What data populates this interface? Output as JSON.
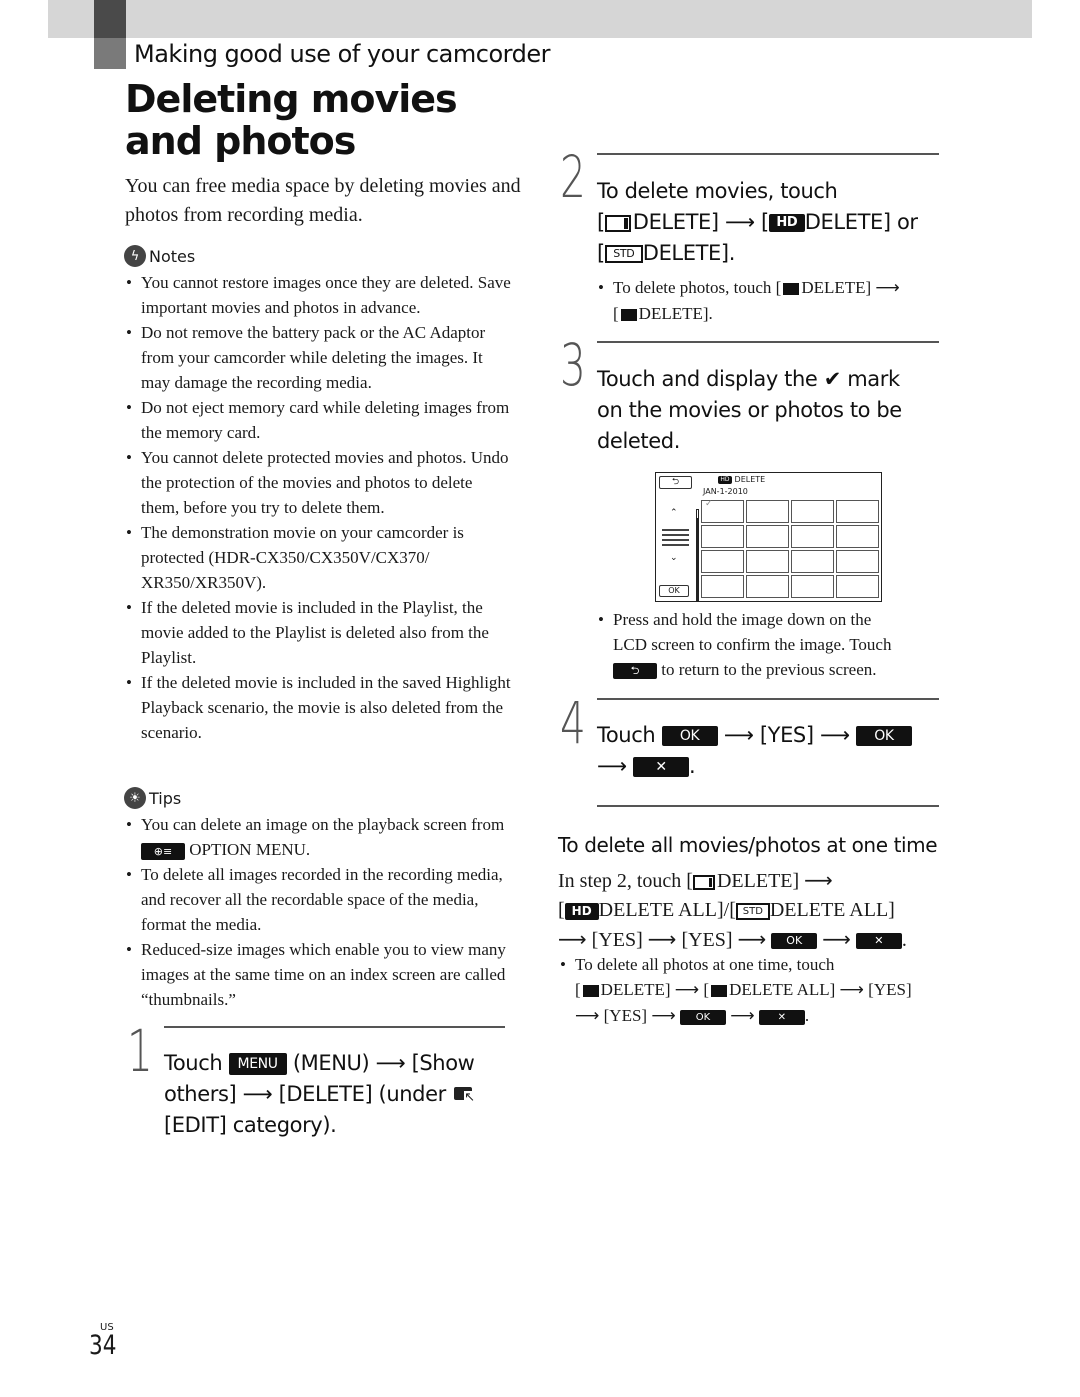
{
  "header": {
    "section": "Making good use of your camcorder",
    "title": "Deleting movies and photos"
  },
  "intro": "You can free media space by deleting movies and photos from recording media.",
  "notes": {
    "heading": "Notes",
    "icon": "notes-icon",
    "items": [
      "You cannot restore images once they are deleted. Save important movies and photos in advance.",
      "Do not remove the battery pack or the AC Adaptor from your camcorder while deleting the images. It may damage the recording media.",
      "Do not eject memory card while deleting images from the memory card.",
      "You cannot delete protected movies and photos. Undo the protection of the movies and photos to delete them, before you try to delete them.",
      "The demonstration movie on your camcorder is protected (HDR-CX350/CX350V/CX370/ XR350/XR350V).",
      "If the deleted movie is included in the Playlist, the movie added to the Playlist is deleted also from the Playlist.",
      "If the deleted movie is included in the saved Highlight Playback scenario, the movie is also deleted from the scenario."
    ]
  },
  "tips": {
    "heading": "Tips",
    "icon": "lightbulb-icon",
    "item1_pre": "You can delete an image on the playback screen from",
    "item1_post": "OPTION MENU.",
    "items": [
      "To delete all images recorded in the recording media, and recover all the recordable space of the media, format the media.",
      "Reduced-size images which enable you to view many images at the same time on an index screen are called “thumbnails.”"
    ]
  },
  "steps": {
    "s1": {
      "num": "1",
      "touch": "Touch",
      "menu_btn": "MENU",
      "t1": "(MENU)",
      "t2": "[Show others]",
      "t3": "[DELETE] (under",
      "t4": "[EDIT] category)."
    },
    "s2": {
      "num": "2",
      "line1": "To delete movies, touch",
      "bracket_open": "[",
      "movie_delete": "DELETE]",
      "hd_delete": "DELETE] or",
      "std_delete": "DELETE].",
      "bullet_pre": "To delete photos, touch [",
      "bullet_delete": "DELETE]",
      "bullet_delete2": "DELETE]."
    },
    "s3": {
      "num": "3",
      "line1_pre": "Touch and display the",
      "line1_post": "mark",
      "line2": "on the movies or photos to be",
      "line3": "deleted.",
      "bullet_l1": "Press and hold the image down on the",
      "bullet_l2": "LCD screen to confirm the image. Touch",
      "bullet_l3": "to return to the previous screen."
    },
    "s4": {
      "num": "4",
      "touch": "Touch",
      "ok": "OK",
      "yes": "[YES]",
      "close": "✕"
    }
  },
  "lcd": {
    "back": "⮌",
    "title": "DELETE",
    "date": "JAN-1-2010",
    "up": "⌃",
    "down": "⌄",
    "ok": "OK",
    "check": "✓",
    "rows": 4,
    "cols": 4
  },
  "delete_all": {
    "title": "To delete all movies/photos at one time",
    "l1_pre": "In step 2, touch [",
    "l1_post": "DELETE]",
    "l2_a": "DELETE ALL]/[",
    "l2_b": "DELETE ALL]",
    "yes": "[YES]",
    "ok": "OK",
    "bullet_l1": "To delete all photos at one time, touch",
    "bullet_delete": "DELETE]",
    "bullet_delete_all": "DELETE ALL]",
    "bullet_yes": "[YES]"
  },
  "footer": {
    "region": "US",
    "page": "34"
  },
  "icon_labels": {
    "hd": "HD",
    "std": "STD"
  }
}
